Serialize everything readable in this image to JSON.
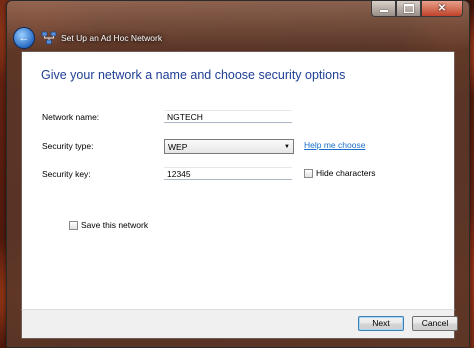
{
  "window": {
    "title": "Set Up an Ad Hoc Network",
    "caption_buttons": {
      "minimize": "minimize",
      "maximize": "maximize",
      "close": "close"
    }
  },
  "main": {
    "heading": "Give your network a name and choose security options",
    "network_name": {
      "label": "Network name:",
      "value": "NGTECH"
    },
    "security_type": {
      "label": "Security type:",
      "selected": "WEP",
      "help_link": "Help me choose"
    },
    "security_key": {
      "label": "Security key:",
      "value": "12345",
      "hide_characters_label": "Hide characters",
      "hide_characters_checked": false
    },
    "save_network": {
      "label": "Save this network",
      "checked": false
    }
  },
  "footer": {
    "next_label": "Next",
    "cancel_label": "Cancel"
  },
  "icons": {
    "back": "back-arrow-icon",
    "network": "network-icon"
  },
  "colors": {
    "heading": "#1f3f95",
    "link": "#1a6fc9"
  }
}
